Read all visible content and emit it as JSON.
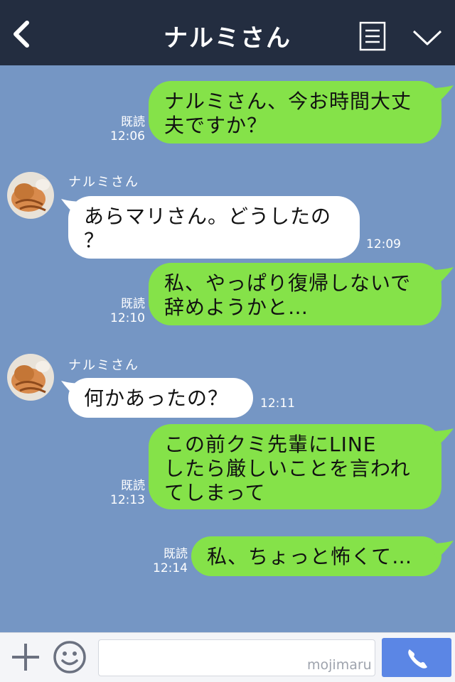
{
  "header": {
    "title": "ナルミさん",
    "back_icon": "chevron-left-icon",
    "menu_icon": "list-icon",
    "down_icon": "chevron-down-icon"
  },
  "messages": [
    {
      "side": "sent",
      "text": "ナルミさん、今お時間大丈\n夫ですか？",
      "read": "既読",
      "time": "12:06"
    },
    {
      "side": "received",
      "sender": "ナルミさん",
      "text": "あらマリさん。どうしたの\n？",
      "time": "12:09"
    },
    {
      "side": "sent",
      "text": "私、やっぱり復帰しないで\n辞めようかと…",
      "read": "既読",
      "time": "12:10"
    },
    {
      "side": "received",
      "sender": "ナルミさん",
      "text": "何かあったの？",
      "time": "12:11"
    },
    {
      "side": "sent",
      "text": "この前クミ先輩にLINE\nしたら厳しいことを言われ\nてしまって",
      "read": "既読",
      "time": "12:13"
    },
    {
      "side": "sent",
      "text": "私、ちょっと怖くて…",
      "read": "既読",
      "time": "12:14"
    }
  ],
  "input_bar": {
    "placeholder": "",
    "watermark": "mojimaru",
    "plus_icon": "plus-icon",
    "emoji_icon": "smiley-icon",
    "call_icon": "phone-icon"
  },
  "colors": {
    "header_bg": "#232d40",
    "chat_bg": "#7596c4",
    "sent_bubble": "#85e249",
    "received_bubble": "#ffffff",
    "call_button": "#5b86e5"
  }
}
